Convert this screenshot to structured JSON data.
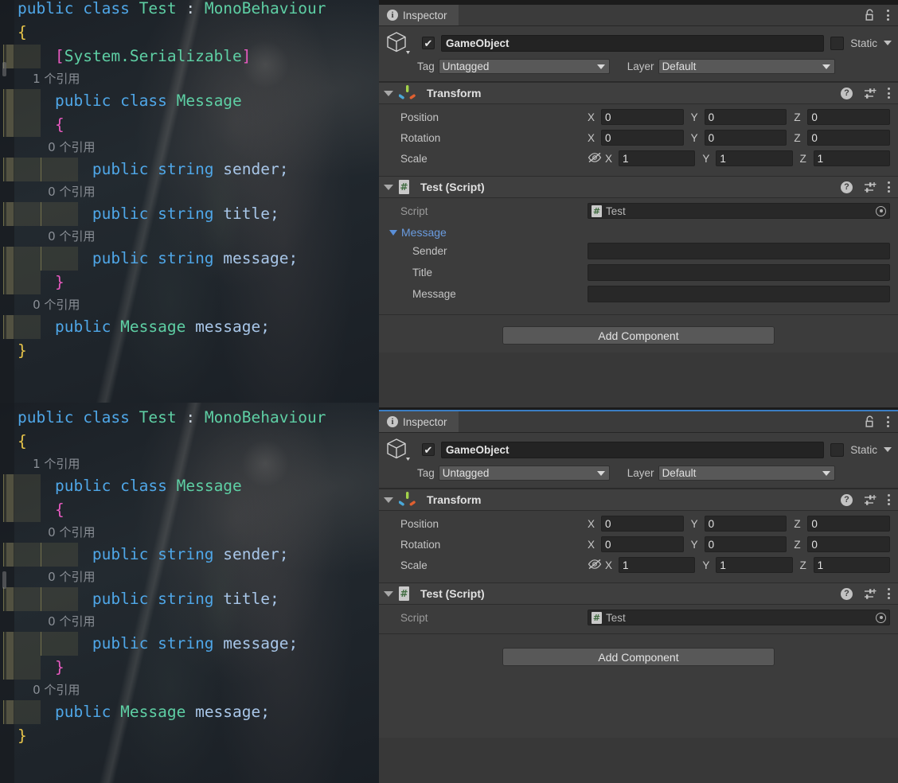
{
  "code_top": {
    "lines": [
      {
        "type": "code",
        "indent": 0,
        "tokens": [
          {
            "t": "public ",
            "c": "kw"
          },
          {
            "t": "class ",
            "c": "kw"
          },
          {
            "t": "Test ",
            "c": "typ"
          },
          {
            "t": ": ",
            "c": "punc"
          },
          {
            "t": "MonoBehaviour",
            "c": "typ"
          }
        ]
      },
      {
        "type": "code",
        "indent": 0,
        "tokens": [
          {
            "t": "{",
            "c": "brc1"
          }
        ]
      },
      {
        "type": "code",
        "indent": 1,
        "tokens": [
          {
            "t": "    ",
            "c": "punc"
          },
          {
            "t": "[",
            "c": "brc2"
          },
          {
            "t": "System.Serializable",
            "c": "atr"
          },
          {
            "t": "]",
            "c": "brc2"
          }
        ]
      },
      {
        "type": "ref",
        "indent": 1,
        "text": "    1 个引用"
      },
      {
        "type": "code",
        "indent": 1,
        "tokens": [
          {
            "t": "    ",
            "c": "punc"
          },
          {
            "t": "public ",
            "c": "kw"
          },
          {
            "t": "class ",
            "c": "kw"
          },
          {
            "t": "Message",
            "c": "typ"
          }
        ]
      },
      {
        "type": "code",
        "indent": 1,
        "tokens": [
          {
            "t": "    ",
            "c": "punc"
          },
          {
            "t": "{",
            "c": "brc2"
          }
        ]
      },
      {
        "type": "ref",
        "indent": 2,
        "text": "        0 个引用"
      },
      {
        "type": "code",
        "indent": 2,
        "tokens": [
          {
            "t": "        ",
            "c": "punc"
          },
          {
            "t": "public ",
            "c": "kw"
          },
          {
            "t": "string ",
            "c": "kw"
          },
          {
            "t": "sender;",
            "c": "idn"
          }
        ]
      },
      {
        "type": "ref",
        "indent": 2,
        "text": "        0 个引用"
      },
      {
        "type": "code",
        "indent": 2,
        "tokens": [
          {
            "t": "        ",
            "c": "punc"
          },
          {
            "t": "public ",
            "c": "kw"
          },
          {
            "t": "string ",
            "c": "kw"
          },
          {
            "t": "title;",
            "c": "idn"
          }
        ]
      },
      {
        "type": "ref",
        "indent": 2,
        "text": "        0 个引用"
      },
      {
        "type": "code",
        "indent": 2,
        "tokens": [
          {
            "t": "        ",
            "c": "punc"
          },
          {
            "t": "public ",
            "c": "kw"
          },
          {
            "t": "string ",
            "c": "kw"
          },
          {
            "t": "message;",
            "c": "idn"
          }
        ]
      },
      {
        "type": "code",
        "indent": 1,
        "tokens": [
          {
            "t": "    ",
            "c": "punc"
          },
          {
            "t": "}",
            "c": "brc2"
          }
        ]
      },
      {
        "type": "ref",
        "indent": 1,
        "text": "    0 个引用"
      },
      {
        "type": "code",
        "indent": 1,
        "tokens": [
          {
            "t": "    ",
            "c": "punc"
          },
          {
            "t": "public ",
            "c": "kw"
          },
          {
            "t": "Message ",
            "c": "typ"
          },
          {
            "t": "message;",
            "c": "idn"
          }
        ]
      },
      {
        "type": "code",
        "indent": 0,
        "tokens": [
          {
            "t": "}",
            "c": "brc1"
          }
        ]
      }
    ]
  },
  "code_bottom": {
    "lines": [
      {
        "type": "code",
        "indent": 0,
        "tokens": [
          {
            "t": "public ",
            "c": "kw"
          },
          {
            "t": "class ",
            "c": "kw"
          },
          {
            "t": "Test ",
            "c": "typ"
          },
          {
            "t": ": ",
            "c": "punc"
          },
          {
            "t": "MonoBehaviour",
            "c": "typ"
          }
        ]
      },
      {
        "type": "code",
        "indent": 0,
        "tokens": [
          {
            "t": "{",
            "c": "brc1"
          }
        ]
      },
      {
        "type": "ref",
        "indent": 1,
        "text": "    1 个引用"
      },
      {
        "type": "code",
        "indent": 1,
        "tokens": [
          {
            "t": "    ",
            "c": "punc"
          },
          {
            "t": "public ",
            "c": "kw"
          },
          {
            "t": "class ",
            "c": "kw"
          },
          {
            "t": "Message",
            "c": "typ"
          }
        ]
      },
      {
        "type": "code",
        "indent": 1,
        "tokens": [
          {
            "t": "    ",
            "c": "punc"
          },
          {
            "t": "{",
            "c": "brc2"
          }
        ]
      },
      {
        "type": "ref",
        "indent": 2,
        "text": "        0 个引用"
      },
      {
        "type": "code",
        "indent": 2,
        "tokens": [
          {
            "t": "        ",
            "c": "punc"
          },
          {
            "t": "public ",
            "c": "kw"
          },
          {
            "t": "string ",
            "c": "kw"
          },
          {
            "t": "sender;",
            "c": "idn"
          }
        ]
      },
      {
        "type": "ref",
        "indent": 2,
        "text": "        0 个引用"
      },
      {
        "type": "code",
        "indent": 2,
        "tokens": [
          {
            "t": "        ",
            "c": "punc"
          },
          {
            "t": "public ",
            "c": "kw"
          },
          {
            "t": "string ",
            "c": "kw"
          },
          {
            "t": "title;",
            "c": "idn"
          }
        ]
      },
      {
        "type": "ref",
        "indent": 2,
        "text": "        0 个引用"
      },
      {
        "type": "code",
        "indent": 2,
        "tokens": [
          {
            "t": "        ",
            "c": "punc"
          },
          {
            "t": "public ",
            "c": "kw"
          },
          {
            "t": "string ",
            "c": "kw"
          },
          {
            "t": "message;",
            "c": "idn"
          }
        ]
      },
      {
        "type": "code",
        "indent": 1,
        "tokens": [
          {
            "t": "    ",
            "c": "punc"
          },
          {
            "t": "}",
            "c": "brc2"
          }
        ]
      },
      {
        "type": "ref",
        "indent": 1,
        "text": "    0 个引用"
      },
      {
        "type": "code",
        "indent": 1,
        "tokens": [
          {
            "t": "    ",
            "c": "punc"
          },
          {
            "t": "public ",
            "c": "kw"
          },
          {
            "t": "Message ",
            "c": "typ"
          },
          {
            "t": "message;",
            "c": "idn"
          }
        ]
      },
      {
        "type": "code",
        "indent": 0,
        "tokens": [
          {
            "t": "}",
            "c": "brc1"
          }
        ]
      }
    ]
  },
  "inspector_top": {
    "tab_label": "Inspector",
    "object": {
      "name": "GameObject",
      "enabled": true,
      "static_label": "Static",
      "tag_label": "Tag",
      "tag_value": "Untagged",
      "layer_label": "Layer",
      "layer_value": "Default"
    },
    "transform": {
      "title": "Transform",
      "rows": [
        {
          "label": "Position",
          "x": "0",
          "y": "0",
          "z": "0"
        },
        {
          "label": "Rotation",
          "x": "0",
          "y": "0",
          "z": "0"
        },
        {
          "label": "Scale",
          "x": "1",
          "y": "1",
          "z": "1"
        }
      ],
      "axis_x": "X",
      "axis_y": "Y",
      "axis_z": "Z"
    },
    "script_component": {
      "title": "Test (Script)",
      "script_label": "Script",
      "script_value": "Test",
      "foldout_label": "Message",
      "fields": [
        {
          "label": "Sender",
          "value": ""
        },
        {
          "label": "Title",
          "value": ""
        },
        {
          "label": "Message",
          "value": ""
        }
      ]
    },
    "add_component_label": "Add Component"
  },
  "inspector_bottom": {
    "tab_label": "Inspector",
    "object": {
      "name": "GameObject",
      "enabled": true,
      "static_label": "Static",
      "tag_label": "Tag",
      "tag_value": "Untagged",
      "layer_label": "Layer",
      "layer_value": "Default"
    },
    "transform": {
      "title": "Transform",
      "rows": [
        {
          "label": "Position",
          "x": "0",
          "y": "0",
          "z": "0"
        },
        {
          "label": "Rotation",
          "x": "0",
          "y": "0",
          "z": "0"
        },
        {
          "label": "Scale",
          "x": "1",
          "y": "1",
          "z": "1"
        }
      ],
      "axis_x": "X",
      "axis_y": "Y",
      "axis_z": "Z"
    },
    "script_component": {
      "title": "Test (Script)",
      "script_label": "Script",
      "script_value": "Test"
    },
    "add_component_label": "Add Component"
  },
  "colors": {
    "panel_bg": "#383838",
    "component_bg": "#3c3c3c",
    "header_bg": "#3f3f3f",
    "field_bg": "#282828",
    "accent_blue": "#3b7ec4",
    "foldout_blue": "#6a9ce0",
    "axis_green": "#a3d24a",
    "axis_blue": "#4aa8d8",
    "axis_orange": "#e06030"
  },
  "glyphs": {
    "check": "✔",
    "info": "i",
    "help": "?"
  }
}
